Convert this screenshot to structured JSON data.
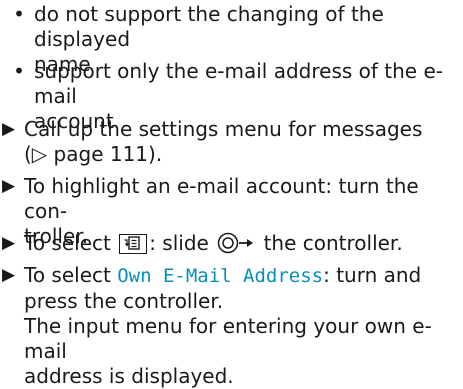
{
  "bullets": [
    {
      "line1": "do not support the changing of the displayed",
      "line2": "name"
    },
    {
      "line1": "support only the e-mail address of the e-mail",
      "line2": "account"
    }
  ],
  "bullet_marker": "•",
  "step_marker": "▶",
  "steps": {
    "s1_line1": "Call up the settings menu for messages",
    "s1_line2": "(▷ page 111).",
    "s2_line1": "To highlight an e-mail account: turn the con-",
    "s2_line2": "troller.",
    "s3_prefix": "To select",
    "s3_mid": ": slide",
    "s3_suffix": "the controller.",
    "s4_prefix": "To select",
    "s4_highlight": "Own E-Mail Address",
    "s4_suffix": ": turn and",
    "s4_line2": "press the controller.",
    "s4_result1": "The input menu for entering your own e-mail",
    "s4_result2": "address is displayed."
  },
  "icons": {
    "menu_key": "menu-button-icon",
    "controller": "controller-slide-right-icon"
  },
  "colors": {
    "text": "#1a1a1a",
    "highlight": "#0a8fb6"
  }
}
